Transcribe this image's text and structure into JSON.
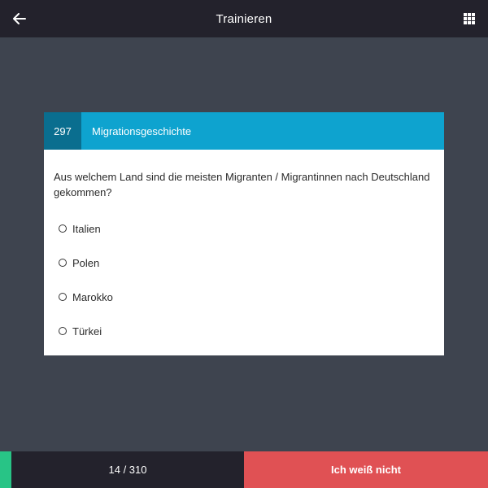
{
  "header": {
    "title": "Trainieren",
    "back_icon": "arrow-left-icon",
    "menu_icon": "grid-icon"
  },
  "question": {
    "number": "297",
    "category": "Migrationsgeschichte",
    "text": "Aus welchem Land sind die meisten Migranten / Migrantinnen nach Deutschland gekommen?",
    "options": [
      "Italien",
      "Polen",
      "Marokko",
      "Türkei"
    ]
  },
  "footer": {
    "progress": "14 / 310",
    "progress_fraction": 0.045,
    "dont_know_label": "Ich weiß nicht"
  },
  "colors": {
    "topbar": "#23222c",
    "background": "#3e444f",
    "card_header": "#0ea3cf",
    "question_number_bg": "#0a6e8f",
    "progress_strip": "#28c486",
    "dont_know": "#e05154"
  }
}
